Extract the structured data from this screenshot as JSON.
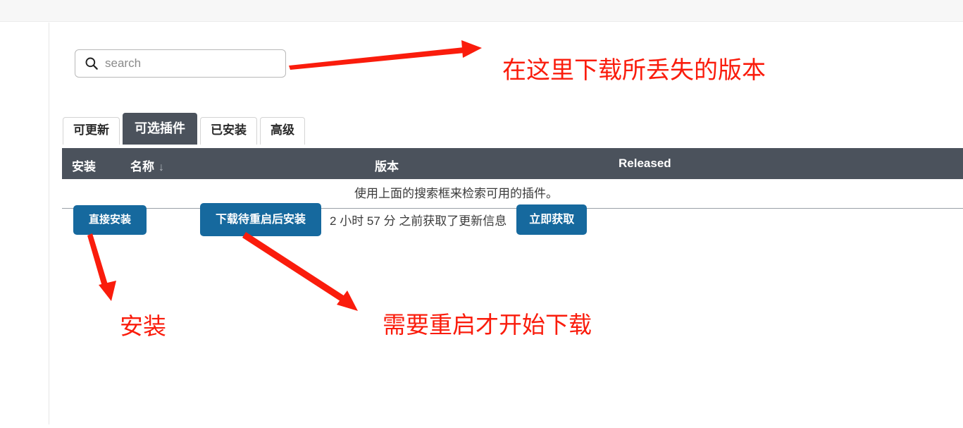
{
  "window": {
    "top_strip_color": "#f7f7f7"
  },
  "search": {
    "icon": "search-icon",
    "value": "",
    "placeholder": "search"
  },
  "tabs": [
    {
      "label": "可更新",
      "active": false
    },
    {
      "label": "可选插件",
      "active": true
    },
    {
      "label": "已安装",
      "active": false
    },
    {
      "label": "高级",
      "active": false
    }
  ],
  "table": {
    "columns": [
      {
        "label": "安装"
      },
      {
        "label": "名称",
        "sort": "↓"
      },
      {
        "label": "版本"
      },
      {
        "label": "Released"
      }
    ],
    "empty_message": "使用上面的搜索框来检索可用的插件。",
    "rows": []
  },
  "actions": {
    "install_now_label": "直接安装",
    "download_restart_label": "下载待重启后安装",
    "update_status": "2 小时 57 分 之前获取了更新信息",
    "check_now_label": "立即获取"
  },
  "annotations": [
    {
      "text": "在这里下载所丢失的版本"
    },
    {
      "text": "安装"
    },
    {
      "text": "需要重启才开始下载"
    }
  ],
  "colors": {
    "accent_blue": "#16699e",
    "header_dark": "#4b525c",
    "annotation_red": "#fa1c0c"
  }
}
